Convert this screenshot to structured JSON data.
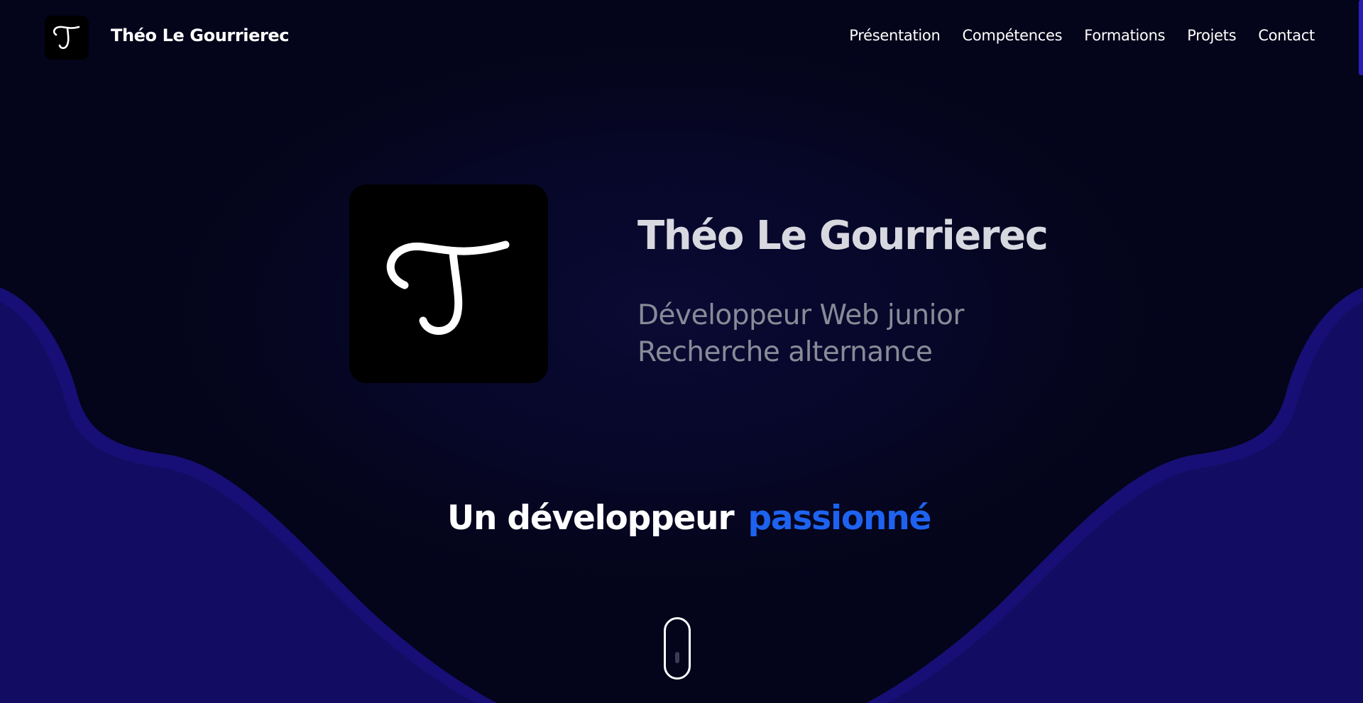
{
  "header": {
    "brand_name": "Théo Le Gourrierec",
    "nav": [
      {
        "label": "Présentation"
      },
      {
        "label": "Compétences"
      },
      {
        "label": "Formations"
      },
      {
        "label": "Projets"
      },
      {
        "label": "Contact"
      }
    ]
  },
  "hero": {
    "name": "Théo Le Gourrierec",
    "role": "Développeur Web junior",
    "status": "Recherche alternance",
    "tagline_main": "Un développeur",
    "tagline_accent": "passionné"
  },
  "icons": {
    "brand_logo": "monogram-t-icon",
    "hero_logo": "monogram-t-icon",
    "scroll_down": "mouse-scroll-icon"
  },
  "colors": {
    "background": "#05051c",
    "wave": "#120d62",
    "wave_edge": "#170f75",
    "accent": "#1e63f0",
    "text_primary": "#ffffff",
    "text_heading": "#d8d8e0",
    "text_muted": "#8a8a98"
  }
}
